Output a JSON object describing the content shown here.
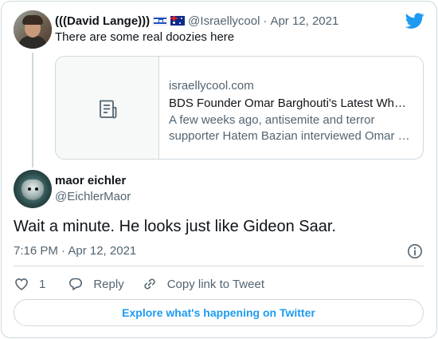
{
  "colors": {
    "accent": "#1d9bf0",
    "text_primary": "#0f1419",
    "text_secondary": "#536471",
    "border": "#cfd9de"
  },
  "parent_tweet": {
    "display_name": "(((David Lange)))",
    "flags": [
      "israel-flag-icon",
      "australia-flag-icon"
    ],
    "handle": "@Israellycool",
    "separator": "·",
    "date": "Apr 12, 2021",
    "text": "There are some real doozies here",
    "link_card": {
      "icon": "document-icon",
      "domain": "israellycool.com",
      "title": "BDS Founder Omar Barghouti's Latest Who…",
      "description_line1": "A few weeks ago, antisemite and terror",
      "description_line2": "supporter Hatem Bazian interviewed Omar …"
    }
  },
  "main_tweet": {
    "display_name": "maor eichler",
    "handle": "@EichlerMaor",
    "text": "Wait a minute. He looks just like Gideon Saar.",
    "timestamp": "7:16 PM · Apr 12, 2021",
    "actions": {
      "like_count": "1",
      "reply_label": "Reply",
      "copy_link_label": "Copy link to Tweet"
    },
    "explore_label": "Explore what's happening on Twitter"
  }
}
